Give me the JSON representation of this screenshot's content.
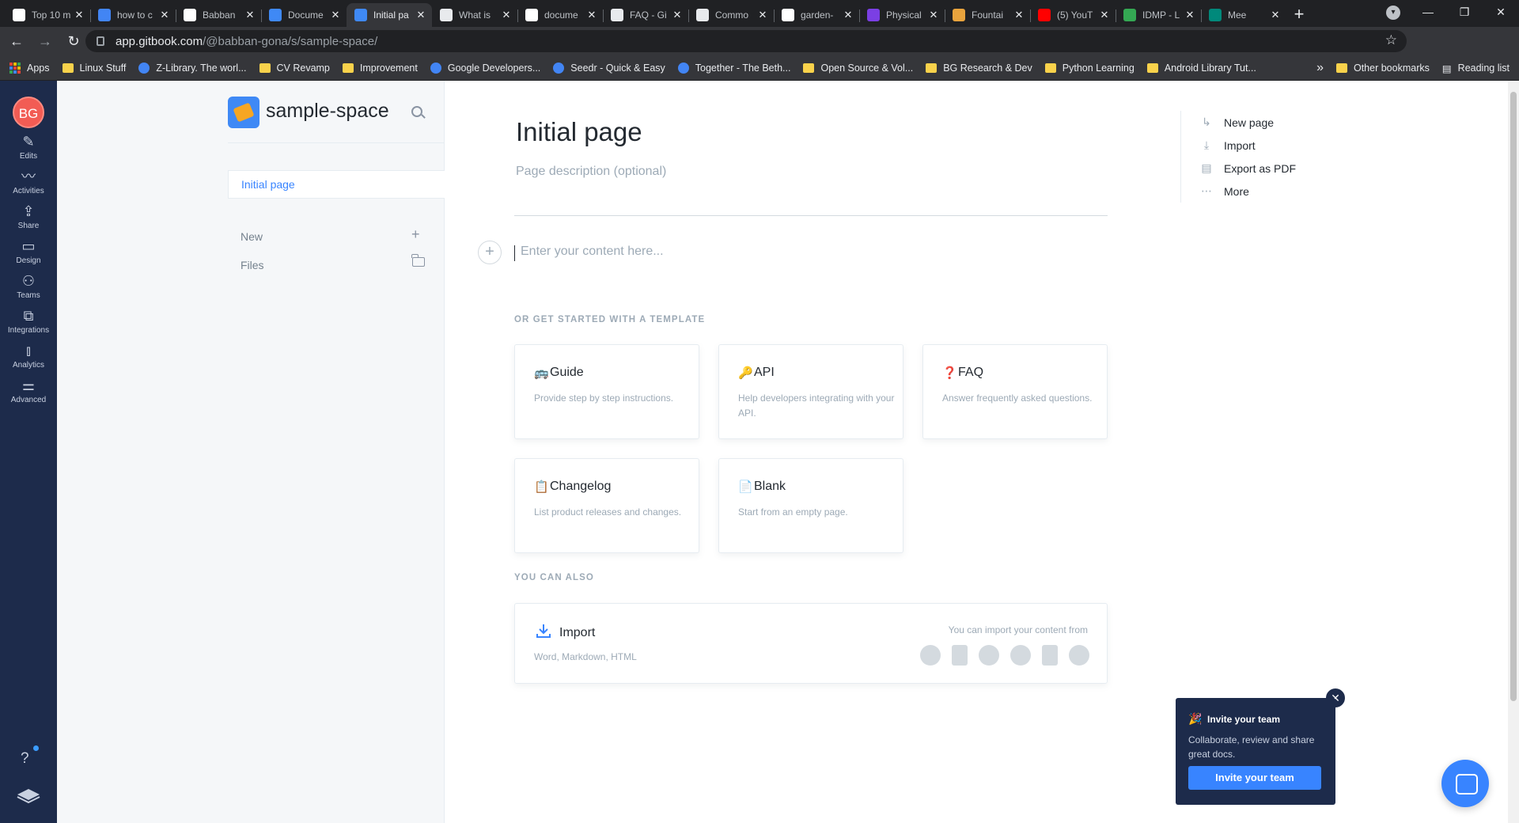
{
  "browser": {
    "tabs": [
      {
        "title": "Top 10 m",
        "color": "#ffffff",
        "active": false
      },
      {
        "title": "how to c",
        "color": "#4285f4",
        "active": false
      },
      {
        "title": "Babban",
        "color": "#ffffff",
        "active": false
      },
      {
        "title": "Docume",
        "color": "#3f89f5",
        "active": false
      },
      {
        "title": "Initial pa",
        "color": "#3f89f5",
        "active": true
      },
      {
        "title": "What is",
        "color": "#e8eaed",
        "active": false
      },
      {
        "title": "docume",
        "color": "#ffffff",
        "active": false
      },
      {
        "title": "FAQ - Gi",
        "color": "#e8eaed",
        "active": false
      },
      {
        "title": "Commo",
        "color": "#e8eaed",
        "active": false
      },
      {
        "title": "garden-",
        "color": "#ffffff",
        "active": false
      },
      {
        "title": "Physical",
        "color": "#7b3fe4",
        "active": false
      },
      {
        "title": "Fountai",
        "color": "#e8a33d",
        "active": false
      },
      {
        "title": "(5) YouT",
        "color": "#ff0000",
        "active": false
      },
      {
        "title": "IDMP - L",
        "color": "#34a853",
        "active": false
      },
      {
        "title": "Mee",
        "color": "#00897b",
        "active": false
      }
    ],
    "url_host": "app.gitbook.com",
    "url_path": "/@babban-gona/s/sample-space/",
    "bookmarks": [
      {
        "label": "Apps",
        "kind": "apps"
      },
      {
        "label": "Linux Stuff",
        "kind": "folder"
      },
      {
        "label": "Z-Library. The worl...",
        "kind": "round"
      },
      {
        "label": "CV Revamp",
        "kind": "folder"
      },
      {
        "label": "Improvement",
        "kind": "folder"
      },
      {
        "label": "Google Developers...",
        "kind": "round"
      },
      {
        "label": "Seedr - Quick & Easy",
        "kind": "round"
      },
      {
        "label": "Together - The Beth...",
        "kind": "round"
      },
      {
        "label": "Open Source & Vol...",
        "kind": "folder"
      },
      {
        "label": "BG Research & Dev",
        "kind": "folder"
      },
      {
        "label": "Python Learning",
        "kind": "folder"
      },
      {
        "label": "Android Library Tut...",
        "kind": "folder"
      }
    ],
    "bookmarks_overflow": "»",
    "other_bookmarks": "Other bookmarks",
    "reading_list": "Reading list"
  },
  "rail": {
    "avatar_initials": "BG",
    "items": [
      {
        "label": "Edits",
        "icon": "pencil-icon",
        "glyph": "✎"
      },
      {
        "label": "Activities",
        "icon": "activity-icon",
        "glyph": "〰"
      },
      {
        "label": "Share",
        "icon": "share-icon",
        "glyph": "⇪"
      },
      {
        "label": "Design",
        "icon": "paint-roller-icon",
        "glyph": "▭"
      },
      {
        "label": "Teams",
        "icon": "people-icon",
        "glyph": "⚇"
      },
      {
        "label": "Integrations",
        "icon": "puzzle-icon",
        "glyph": "⧉"
      },
      {
        "label": "Analytics",
        "icon": "bar-chart-icon",
        "glyph": "⫾"
      },
      {
        "label": "Advanced",
        "icon": "sliders-icon",
        "glyph": "⚌"
      }
    ],
    "help_glyph": "?"
  },
  "sidebar": {
    "space_title": "sample-space",
    "pages": [
      {
        "label": "Initial page",
        "selected": true
      }
    ],
    "new_label": "New",
    "files_label": "Files"
  },
  "main": {
    "page_title": "Initial page",
    "description_placeholder": "Page description (optional)",
    "content_placeholder": "Enter your content here...",
    "templates_heading": "OR GET STARTED WITH A TEMPLATE",
    "templates": [
      {
        "title": "Guide",
        "emoji": "🚌",
        "description": "Provide step by step instructions."
      },
      {
        "title": "API",
        "emoji": "🔑",
        "description": "Help developers integrating with your API."
      },
      {
        "title": "FAQ",
        "emoji": "❓",
        "description": "Answer frequently asked questions."
      },
      {
        "title": "Changelog",
        "emoji": "📋",
        "description": "List product releases and changes."
      },
      {
        "title": "Blank",
        "emoji": "📄",
        "description": "Start from an empty page."
      }
    ],
    "also_heading": "YOU CAN ALSO",
    "import": {
      "title": "Import",
      "description": "Word, Markdown, HTML",
      "note": "You can import your content from",
      "sources": [
        "confluence-icon",
        "document-icon",
        "github-icon",
        "dropbox-icon",
        "notion-icon",
        "quip-icon"
      ]
    }
  },
  "page_actions": [
    {
      "label": "New page",
      "icon": "new-page-icon",
      "glyph": "↳"
    },
    {
      "label": "Import",
      "icon": "import-icon",
      "glyph": "⤓"
    },
    {
      "label": "Export as PDF",
      "icon": "pdf-icon",
      "glyph": "▤"
    },
    {
      "label": "More",
      "icon": "more-icon",
      "glyph": "⋯"
    }
  ],
  "invite": {
    "emoji": "🎉",
    "title": "Invite your team",
    "description": "Collaborate, review and share great docs.",
    "button": "Invite your team",
    "close": "✕"
  },
  "colors": {
    "accent": "#3884ff",
    "rail": "#1d2b4b",
    "avatar": "#f25c54"
  }
}
